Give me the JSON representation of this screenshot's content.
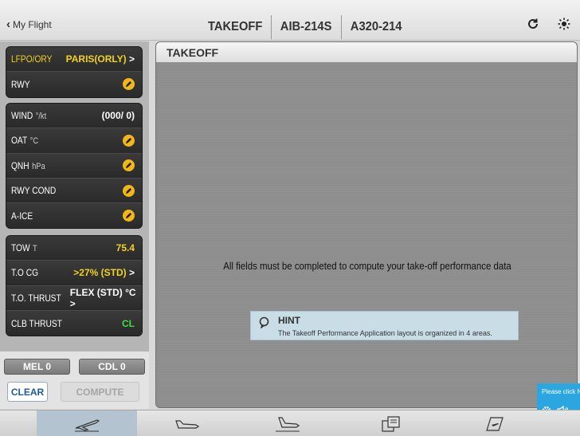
{
  "header": {
    "back_label": "My Flight",
    "titles": [
      "TAKEOFF",
      "AIB-214S",
      "A320-214"
    ],
    "icons": [
      "refresh-icon",
      "brightness-icon"
    ]
  },
  "left_panel": {
    "group1": [
      {
        "label": "LFPO/ORY",
        "value": "PARIS(ORLY)",
        "value_color": "yellow",
        "chevron": true
      },
      {
        "label": "RWY",
        "value": "",
        "pencil": true
      }
    ],
    "group2": [
      {
        "label": "WIND",
        "unit": "°/kt",
        "value": "(000/ 0)",
        "value_color": "white"
      },
      {
        "label": "OAT",
        "unit": "°C",
        "value": "",
        "pencil": true
      },
      {
        "label": "QNH",
        "unit": "hPa",
        "value": "",
        "pencil": true
      },
      {
        "label": "RWY COND",
        "unit": "",
        "value": "",
        "pencil": true
      },
      {
        "label": "A-ICE",
        "unit": "",
        "value": "",
        "pencil": true
      }
    ],
    "group3": [
      {
        "label": "TOW",
        "unit": "T",
        "value": "75.4",
        "value_color": "yellow"
      },
      {
        "label": "T.O CG",
        "unit": "",
        "value": ">27% (STD)",
        "value_color": "yellow",
        "chevron": true
      },
      {
        "label": "T.O. THRUST",
        "unit": "",
        "value": "FLEX (STD) °C",
        "value_color": "white",
        "chevron": true
      },
      {
        "label": "CLB THRUST",
        "unit": "",
        "value": "CL",
        "value_color": "green"
      }
    ],
    "buttons": {
      "mel": "MEL 0",
      "cdl": "CDL 0",
      "clear": "CLEAR",
      "compute": "COMPUTE"
    }
  },
  "main": {
    "header": "TAKEOFF",
    "message": "All fields must be completed to compute your take-off performance data",
    "hint": {
      "title": "HINT",
      "text": "The Takeoff Performance Application layout is organized in 4 areas."
    }
  },
  "help_tab": {
    "text": "Please click N"
  },
  "tabbar": {
    "tabs": [
      "takeoff-tab",
      "landing-tab",
      "inflight-landing-tab",
      "documents-tab",
      "weight-balance-tab"
    ],
    "active_index": 0
  },
  "colors": {
    "value_yellow": "#f2d21b",
    "value_green": "#3fdc3f",
    "accent_blue": "#2ba6e0",
    "hint_bg": "#c9dde6"
  }
}
